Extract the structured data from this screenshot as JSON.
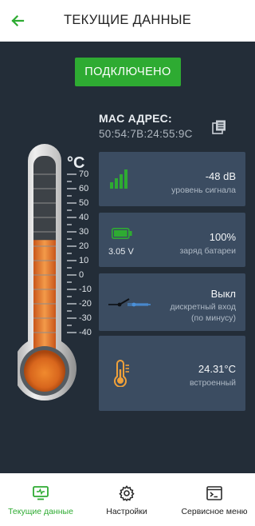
{
  "header": {
    "title": "ТЕКУЩИЕ ДАННЫЕ",
    "back_icon": "arrow-left-icon",
    "accent": "#2eab32"
  },
  "status": {
    "label": "ПОДКЛЮЧЕНО",
    "color": "#2eab32"
  },
  "mac": {
    "label": "MAC АДРЕС:",
    "value": "50:54:7B:24:55:9C",
    "copy_icon": "copy-icon"
  },
  "thermometer": {
    "unit": "°C",
    "scale": [
      "70",
      "60",
      "50",
      "40",
      "30",
      "20",
      "10",
      "0",
      "-10",
      "-20",
      "-30",
      "-40"
    ],
    "current_value": 24.31,
    "range": [
      -40,
      70
    ],
    "fill_color": "#e87a22"
  },
  "cards": {
    "signal": {
      "value": "-48 dB",
      "sub": "уровень сигнала",
      "icon": "signal-bars-icon",
      "color": "#2eab32"
    },
    "battery": {
      "value": "100%",
      "sub": "заряд батареи",
      "voltage": "3.05 V",
      "icon": "battery-icon",
      "color": "#2eab32"
    },
    "input": {
      "value": "Выкл",
      "sub_line1": "дискретный вход",
      "sub_line2": "(по минусу)",
      "icon": "switch-open-icon"
    },
    "temp": {
      "value": "24.31°C",
      "sub": "встроенный",
      "icon": "thermometer-icon",
      "color": "#f0a13a"
    }
  },
  "nav": {
    "items": [
      {
        "label": "Текущие данные",
        "icon": "monitor-icon",
        "active": true
      },
      {
        "label": "Настройки",
        "icon": "gear-icon",
        "active": false
      },
      {
        "label": "Сервисное меню",
        "icon": "terminal-icon",
        "active": false
      }
    ]
  }
}
